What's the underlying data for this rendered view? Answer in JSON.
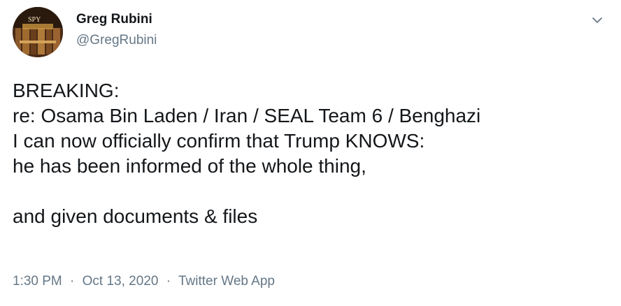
{
  "author": {
    "name": "Greg Rubini",
    "handle": "@GregRubini",
    "avatar_text": "SPY"
  },
  "menu": {
    "icon": "chevron-down-icon"
  },
  "tweet": {
    "lines": [
      "BREAKING:",
      "re: Osama Bin Laden / Iran / SEAL Team 6 / Benghazi",
      "I can now officially confirm that Trump KNOWS:",
      "he has been informed of the whole thing,",
      "",
      "and given documents & files"
    ]
  },
  "meta": {
    "time": "1:30 PM",
    "date": "Oct 13, 2020",
    "separator": "·",
    "source": "Twitter Web App"
  },
  "colors": {
    "text": "#14171a",
    "secondary": "#657786"
  }
}
